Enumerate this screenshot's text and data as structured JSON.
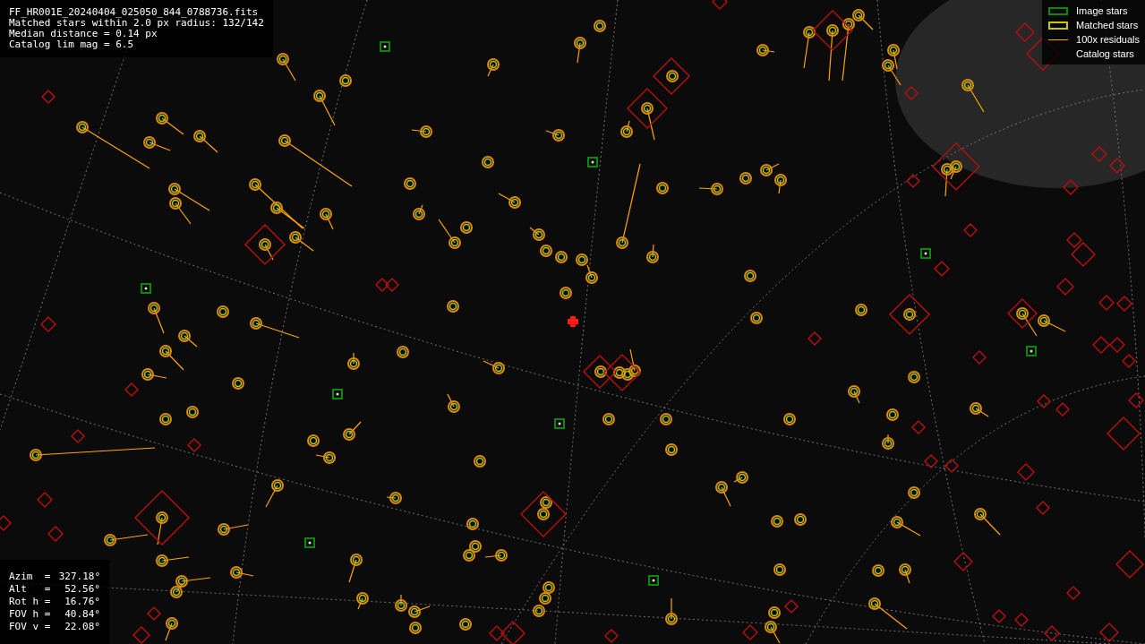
{
  "header_lines": [
    "FF_HR001E_20240404_025050_844_0788736.fits",
    "Matched stars within 2.0 px radius: 132/142",
    "Median distance = 0.14 px",
    "Catalog lim mag = 6.5"
  ],
  "legend": [
    {
      "kind": "image",
      "label": "Image stars"
    },
    {
      "kind": "matched",
      "label": "Matched stars"
    },
    {
      "kind": "residual",
      "label": "100x residuals"
    },
    {
      "kind": "catalog",
      "label": "Catalog stars"
    }
  ],
  "pointing": [
    {
      "label": "Azim",
      "sep": "=",
      "value": "327.18°"
    },
    {
      "label": "Alt",
      "sep": "=",
      "value": "52.56°"
    },
    {
      "label": "Rot h",
      "sep": "=",
      "value": "16.76°"
    },
    {
      "label": "FOV h",
      "sep": "=",
      "value": "40.84°"
    },
    {
      "label": "FOV v",
      "sep": "=",
      "value": "22.08°"
    }
  ]
}
